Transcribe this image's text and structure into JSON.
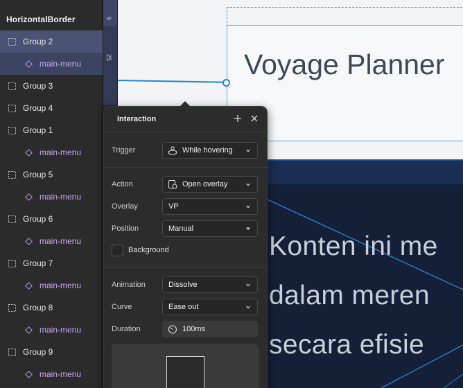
{
  "layers": {
    "header": "HorizontalBorder",
    "items": [
      {
        "label": "Group 2",
        "type": "group",
        "selected": true
      },
      {
        "label": "main-menu",
        "type": "component",
        "selected": true
      },
      {
        "label": "Group 3",
        "type": "group"
      },
      {
        "label": "Group 4",
        "type": "group"
      },
      {
        "label": "Group 1",
        "type": "group"
      },
      {
        "label": "main-menu",
        "type": "component"
      },
      {
        "label": "Group 5",
        "type": "group"
      },
      {
        "label": "main-menu",
        "type": "component"
      },
      {
        "label": "Group 6",
        "type": "group"
      },
      {
        "label": "main-menu",
        "type": "component"
      },
      {
        "label": "Group 7",
        "type": "group"
      },
      {
        "label": "main-menu",
        "type": "component"
      },
      {
        "label": "Group 8",
        "type": "group"
      },
      {
        "label": "main-menu",
        "type": "component"
      },
      {
        "label": "Group 9",
        "type": "group"
      },
      {
        "label": "main-menu",
        "type": "component"
      }
    ]
  },
  "ruler": {
    "top_value": "9",
    "span_value": "25"
  },
  "canvas": {
    "title": "Voyage Planner",
    "hero_lines": [
      "Konten ini me",
      "dalam meren",
      "secara efisie"
    ]
  },
  "interaction": {
    "title": "Interaction",
    "add_icon": "plus-icon",
    "close_icon": "close-icon",
    "trigger_label": "Trigger",
    "trigger_value": "While hovering",
    "action_label": "Action",
    "action_value": "Open overlay",
    "overlay_label": "Overlay",
    "overlay_value": "VP",
    "position_label": "Position",
    "position_value": "Manual",
    "background_label": "Background",
    "animation_label": "Animation",
    "animation_value": "Dissolve",
    "curve_label": "Curve",
    "curve_value": "Ease out",
    "duration_label": "Duration",
    "duration_value": "100ms"
  },
  "colors": {
    "selection": "#4b5374",
    "component_text": "#c9a6f2",
    "link_blue": "#1b86d6",
    "hero_bg": "#142038"
  }
}
